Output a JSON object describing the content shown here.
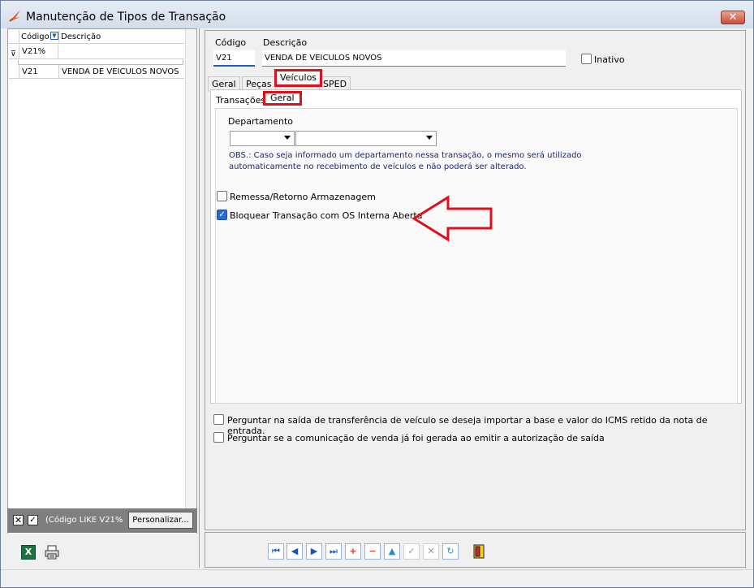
{
  "window": {
    "title": "Manutenção de Tipos de Transação",
    "close_label": "✕"
  },
  "left_grid": {
    "columns": [
      "Código",
      "Descrição"
    ],
    "filter_value": "V21%",
    "rows": [
      {
        "codigo": "V21",
        "descricao": "VENDA DE VEICULOS NOVOS"
      }
    ],
    "filter_text": "(Código LIKE V21%",
    "customize_label": "Personalizar..."
  },
  "form": {
    "codigo_label": "Código",
    "descricao_label": "Descrição",
    "codigo_value": "V21",
    "descricao_value": "VENDA DE VEICULOS NOVOS",
    "inativo_label": "Inativo",
    "inativo_checked": false
  },
  "tabs": [
    "Geral",
    "Peças",
    "Veículos",
    "SPED"
  ],
  "active_tab": "Veículos",
  "subtabs": [
    "Transações",
    "Geral"
  ],
  "active_subtab": "Geral",
  "veiculos_geral": {
    "departamento_label": "Departamento",
    "obs_line1": "OBS.: Caso seja informado um departamento nessa transação, o mesmo será utilizado",
    "obs_line2": "automaticamente no recebimento de veículos e não poderá ser alterado.",
    "remessa_label": "Remessa/Retorno Armazenagem",
    "remessa_checked": false,
    "bloquear_label": "Bloquear Transação com OS Interna Aberta",
    "bloquear_checked": true
  },
  "options": {
    "perguntar_transferencia": "Perguntar na saída de transferência de veículo se deseja importar a base e valor do ICMS retido da nota de entrada.",
    "perguntar_comunicacao": "Perguntar se a comunicação de venda já foi gerada ao emitir a autorização de saída"
  },
  "colors": {
    "highlight_red": "#e0101a",
    "accent_blue": "#1a5fbf",
    "obs_text": "#1a237e"
  }
}
